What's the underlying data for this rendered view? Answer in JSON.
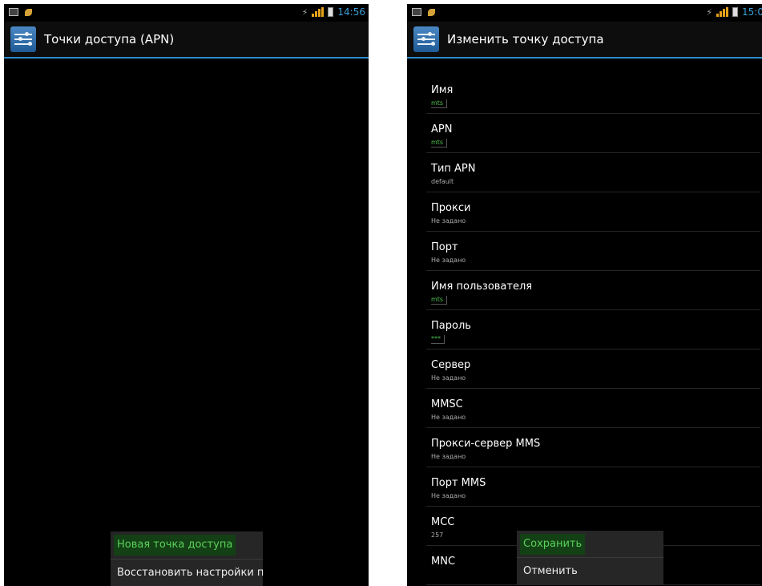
{
  "left": {
    "statusbar": {
      "time": "14:56"
    },
    "actionbar": {
      "title": "Точки доступа (APN)"
    },
    "menu": [
      {
        "label": "Новая точка доступа",
        "highlighted": true
      },
      {
        "label": "Восстановить настройки п",
        "highlighted": false
      }
    ]
  },
  "right": {
    "statusbar": {
      "time": "15:0"
    },
    "actionbar": {
      "title": "Изменить точку доступа"
    },
    "fields": [
      {
        "title": "Имя",
        "summary": "mts"
      },
      {
        "title": "APN",
        "summary": "mts"
      },
      {
        "title": "Тип APN",
        "summary": "default"
      },
      {
        "title": "Прокси",
        "summary": "Не задано"
      },
      {
        "title": "Порт",
        "summary": "Не задано"
      },
      {
        "title": "Имя пользователя",
        "summary": "mts"
      },
      {
        "title": "Пароль",
        "summary": "***"
      },
      {
        "title": "Сервер",
        "summary": "Не задано"
      },
      {
        "title": "MMSC",
        "summary": "Не задано"
      },
      {
        "title": "Прокси-сервер MMS",
        "summary": "Не задано"
      },
      {
        "title": "Порт MMS",
        "summary": "Не задано"
      },
      {
        "title": "MCC",
        "summary": "257"
      },
      {
        "title": "MNC",
        "summary": ""
      }
    ],
    "menu": [
      {
        "label": "Сохранить",
        "highlighted": true
      },
      {
        "label": "Отменить",
        "highlighted": false
      }
    ]
  },
  "colors": {
    "accent": "#2f8bc9",
    "highlight_text": "#5bd05b",
    "highlight_bg": "#134014"
  }
}
